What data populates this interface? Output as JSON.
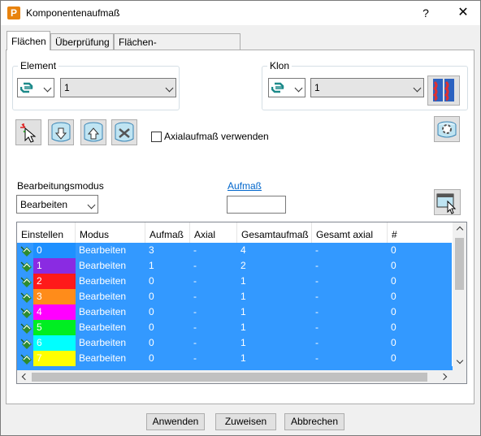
{
  "window": {
    "title": "Komponentenaufmaß",
    "app_icon_letter": "P",
    "help_label": "?",
    "close_label": "✕"
  },
  "tabs": [
    {
      "label": "Flächen",
      "active": true
    },
    {
      "label": "Überprüfung",
      "active": false
    },
    {
      "label": "Flächen-Standardvorgaben",
      "active": false
    }
  ],
  "element": {
    "group_label": "Element",
    "icon": "surface-type-icon",
    "value": "1"
  },
  "klon": {
    "group_label": "Klon",
    "icon": "surface-type-icon",
    "value": "1"
  },
  "toolbar_icons": [
    "select-surfaces-icon",
    "database-down-icon",
    "database-up-icon",
    "database-tools-icon",
    "settings-drum-icon"
  ],
  "axial_checkbox": {
    "label": "Axialaufmaß verwenden",
    "checked": false
  },
  "bearbeitungsmodus": {
    "label": "Bearbeitungsmodus",
    "value": "Bearbeiten"
  },
  "aufmass": {
    "label": "Aufmaß",
    "value": ""
  },
  "table": {
    "columns": [
      "Einstellen",
      "Modus",
      "Aufmaß",
      "Axial",
      "Gesamtaufmaß",
      "Gesamt axial",
      "#"
    ],
    "rows": [
      {
        "id": "0",
        "color": "#1e90ff",
        "modus": "Bearbeiten",
        "aufmass": "3",
        "axial": "-",
        "gesamt": "4",
        "gesamt_axial": "-",
        "count": "0"
      },
      {
        "id": "1",
        "color": "#8a2be2",
        "modus": "Bearbeiten",
        "aufmass": "1",
        "axial": "-",
        "gesamt": "2",
        "gesamt_axial": "-",
        "count": "0"
      },
      {
        "id": "2",
        "color": "#ff1a1a",
        "modus": "Bearbeiten",
        "aufmass": "0",
        "axial": "-",
        "gesamt": "1",
        "gesamt_axial": "-",
        "count": "0"
      },
      {
        "id": "3",
        "color": "#ff8c1a",
        "modus": "Bearbeiten",
        "aufmass": "0",
        "axial": "-",
        "gesamt": "1",
        "gesamt_axial": "-",
        "count": "0"
      },
      {
        "id": "4",
        "color": "#ff00ff",
        "modus": "Bearbeiten",
        "aufmass": "0",
        "axial": "-",
        "gesamt": "1",
        "gesamt_axial": "-",
        "count": "0"
      },
      {
        "id": "5",
        "color": "#00ee22",
        "modus": "Bearbeiten",
        "aufmass": "0",
        "axial": "-",
        "gesamt": "1",
        "gesamt_axial": "-",
        "count": "0"
      },
      {
        "id": "6",
        "color": "#00ffff",
        "modus": "Bearbeiten",
        "aufmass": "0",
        "axial": "-",
        "gesamt": "1",
        "gesamt_axial": "-",
        "count": "0"
      },
      {
        "id": "7",
        "color": "#ffff00",
        "modus": "Bearbeiten",
        "aufmass": "0",
        "axial": "-",
        "gesamt": "1",
        "gesamt_axial": "-",
        "count": "0"
      }
    ]
  },
  "buttons": {
    "apply": "Anwenden",
    "assign": "Zuweisen",
    "cancel": "Abbrechen"
  }
}
